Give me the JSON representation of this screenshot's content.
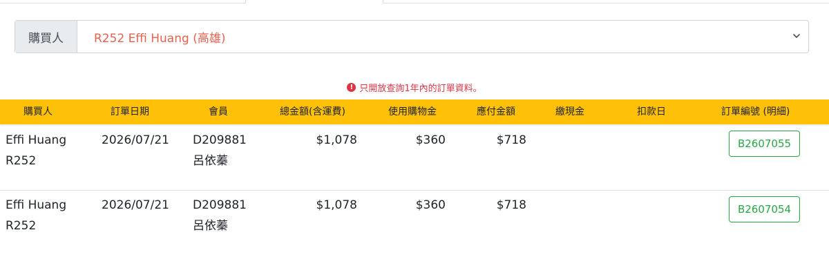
{
  "buyer": {
    "label": "購買人",
    "selected": "R252 Effi Huang (高雄)"
  },
  "notice": {
    "text": "只開放查詢1年內的訂單資料。"
  },
  "table": {
    "headers": [
      "購買人",
      "訂單日期",
      "會員",
      "總金額(含運費)",
      "使用購物金",
      "應付金額",
      "繳現金",
      "扣款日",
      "訂單編號 (明細)"
    ],
    "rows": [
      {
        "buyer_name": "Effi Huang",
        "buyer_code": "R252",
        "date": "2026/07/21",
        "member_id": "D209881",
        "member_name": "呂依蓁",
        "total": "$1,078",
        "credit_used": "$360",
        "payable": "$718",
        "cash": "",
        "debit_date": "",
        "order_no": "B2607055"
      },
      {
        "buyer_name": "Effi Huang",
        "buyer_code": "R252",
        "date": "2026/07/21",
        "member_id": "D209881",
        "member_name": "呂依蓁",
        "total": "$1,078",
        "credit_used": "$360",
        "payable": "$718",
        "cash": "",
        "debit_date": "",
        "order_no": "B2607054"
      }
    ]
  },
  "colors": {
    "header_bg": "#ffc107",
    "notice": "#dc3545",
    "select_text": "#e8614d",
    "order_btn": "#28a745"
  },
  "icons": {
    "notice": "exclamation-circle-icon",
    "select": "chevron-down-icon"
  }
}
